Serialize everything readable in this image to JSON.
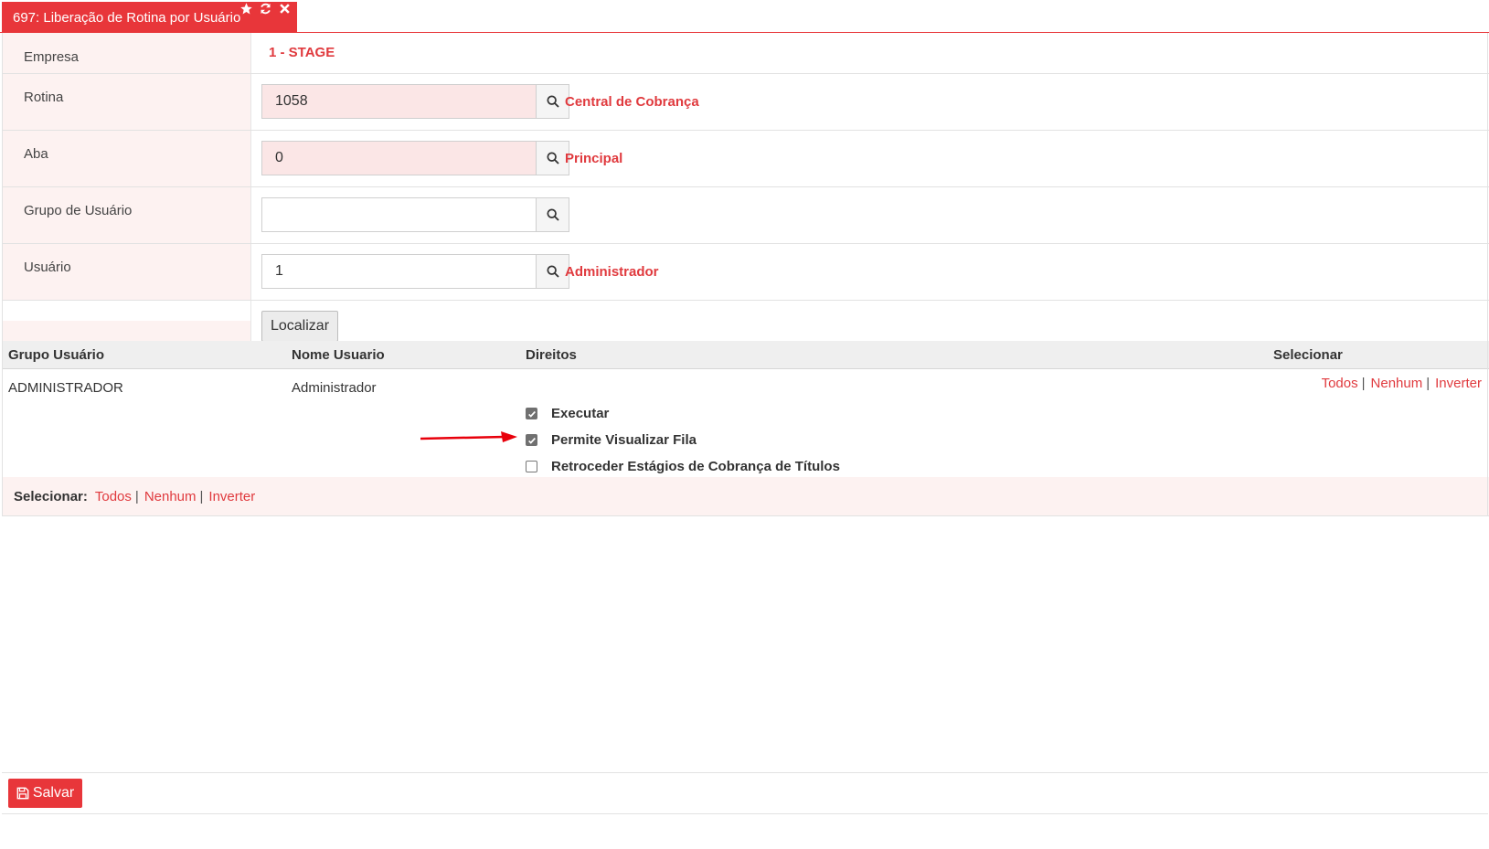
{
  "tab": {
    "title": "697: Liberação de Rotina por Usuário",
    "icons": [
      "star-icon",
      "refresh-icon",
      "close-icon"
    ]
  },
  "form": {
    "empresa": {
      "label": "Empresa",
      "value": "1 - STAGE"
    },
    "rotina": {
      "label": "Rotina",
      "value": "1058",
      "description": "Central de Cobrança"
    },
    "aba": {
      "label": "Aba",
      "value": "0",
      "description": "Principal"
    },
    "grupo_usuario": {
      "label": "Grupo de Usuário",
      "value": ""
    },
    "usuario": {
      "label": "Usuário",
      "value": "1",
      "description": "Administrador"
    },
    "localizar_label": "Localizar"
  },
  "table": {
    "headers": {
      "grupo": "Grupo Usuário",
      "nome": "Nome Usuario",
      "direitos": "Direitos",
      "selecionar": "Selecionar"
    },
    "rows": [
      {
        "grupo": "ADMINISTRADOR",
        "nome": "Administrador",
        "direitos": [
          {
            "label": "Executar",
            "checked": true
          },
          {
            "label": "Permite Visualizar Fila",
            "checked": true
          },
          {
            "label": "Retroceder Estágios de Cobrança de Títulos",
            "checked": false
          }
        ],
        "links": {
          "todos": "Todos",
          "nenhum": "Nenhum",
          "inverter": "Inverter"
        }
      }
    ]
  },
  "footer_select": {
    "label": "Selecionar:",
    "todos": "Todos",
    "nenhum": "Nenhum",
    "inverter": "Inverter"
  },
  "bottom": {
    "save_label": "Salvar"
  },
  "colors": {
    "accent": "#e8363a",
    "link": "#e03a3e",
    "label_bg": "#fdf2f1"
  }
}
